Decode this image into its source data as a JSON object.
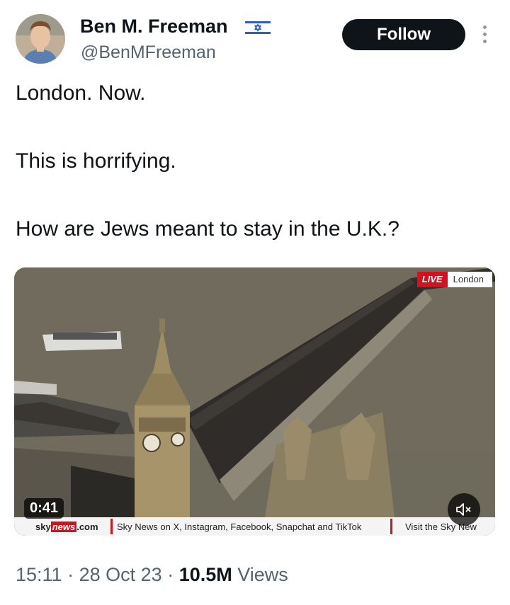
{
  "author": {
    "display_name": "Ben M. Freeman",
    "handle": "@BenMFreeman",
    "flag_icon": "israel-flag-icon"
  },
  "actions": {
    "follow_label": "Follow",
    "more_icon": "more-vertical-icon"
  },
  "tweet": {
    "lines": [
      "London. Now.",
      "This is horrifying.",
      "How are Jews meant to stay in the U.K.?"
    ]
  },
  "media": {
    "live_label": "LIVE",
    "location_label": "London",
    "duration": "0:41",
    "ticker_brand_a": "sky",
    "ticker_brand_b": "news",
    "ticker_brand_c": ".com",
    "ticker_message": "Sky News on X, Instagram, Facebook, Snapchat and TikTok",
    "ticker_visit": "Visit the Sky New",
    "mute_icon": "speaker-muted-icon"
  },
  "meta": {
    "time": "15:11",
    "date": "28 Oct 23",
    "views_count": "10.5M",
    "views_label": "Views",
    "separator": "·"
  },
  "colors": {
    "text_primary": "#0f1419",
    "text_secondary": "#536471",
    "follow_bg": "#0f1419",
    "sky_red": "#d3121f"
  }
}
